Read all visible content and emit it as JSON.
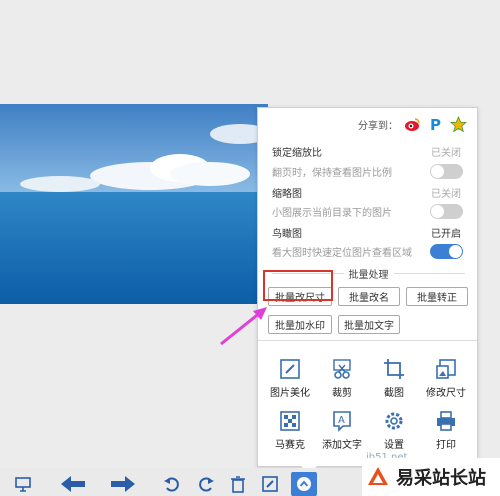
{
  "share": {
    "label": "分享到："
  },
  "settings": [
    {
      "title": "锁定缩放比",
      "status": "已关闭",
      "desc": "翻页时，保持查看图片比例",
      "on": false
    },
    {
      "title": "缩略图",
      "status": "已关闭",
      "desc": "小图展示当前目录下的图片",
      "on": false
    },
    {
      "title": "鸟瞰图",
      "status": "已开启",
      "desc": "看大图时快速定位图片查看区域",
      "on": true
    }
  ],
  "batch": {
    "title": "批量处理",
    "buttons": [
      "批量改尺寸",
      "批量改名",
      "批量转正",
      "批量加水印",
      "批量加文字"
    ]
  },
  "tools": [
    "图片美化",
    "裁剪",
    "截图",
    "修改尺寸",
    "马赛克",
    "添加文字",
    "设置",
    "打印"
  ],
  "watermark": {
    "text": "易采站长站",
    "url": "jb51.net"
  }
}
